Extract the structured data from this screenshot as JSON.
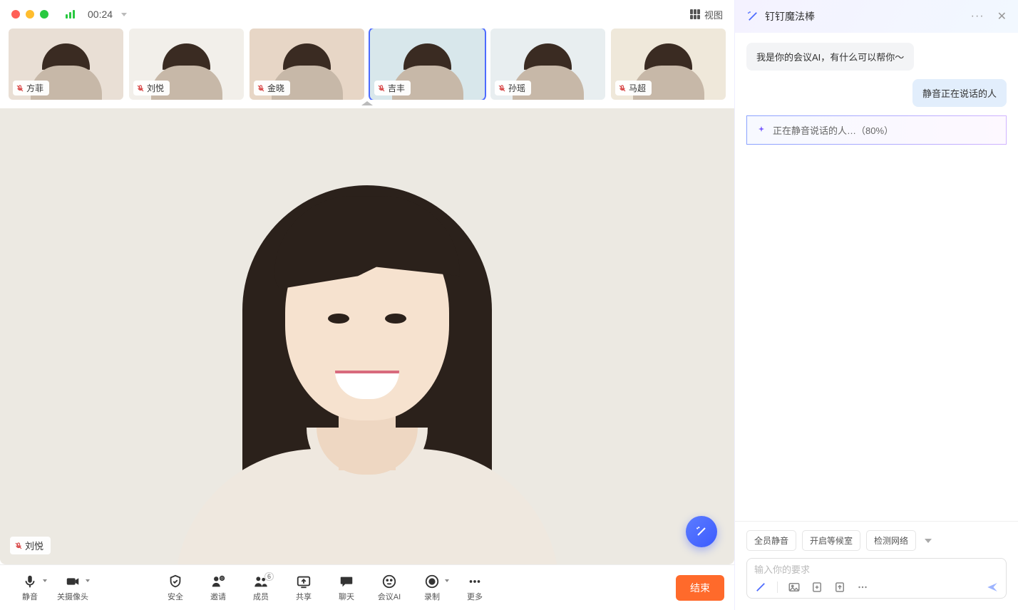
{
  "header": {
    "timer": "00:24",
    "view_label": "视图"
  },
  "participants": [
    {
      "name": "方菲"
    },
    {
      "name": "刘悦"
    },
    {
      "name": "金晓"
    },
    {
      "name": "吉丰"
    },
    {
      "name": "孙瑶"
    },
    {
      "name": "马超"
    }
  ],
  "participant_bg": [
    "#e9dfd5",
    "#f2efea",
    "#e7d6c6",
    "#d8e7eb",
    "#e8eef0",
    "#efe8da"
  ],
  "main_speaker": {
    "name": "刘悦"
  },
  "controls": {
    "mute": "静音",
    "camera": "关摄像头",
    "security": "安全",
    "invite": "邀请",
    "members": "成员",
    "members_count": "6",
    "share": "共享",
    "chat": "聊天",
    "meeting_ai": "会议AI",
    "record": "录制",
    "more": "更多",
    "end": "结束"
  },
  "ai_panel": {
    "title": "钉钉魔法棒",
    "messages": {
      "ai": "我是你的会议AI，有什么可以帮你～",
      "user": "静音正在说话的人"
    },
    "status": "正在静音说话的人…（80%）",
    "quick_actions": [
      "全员静音",
      "开启等候室",
      "检测网络"
    ],
    "input_placeholder": "输入你的要求"
  }
}
